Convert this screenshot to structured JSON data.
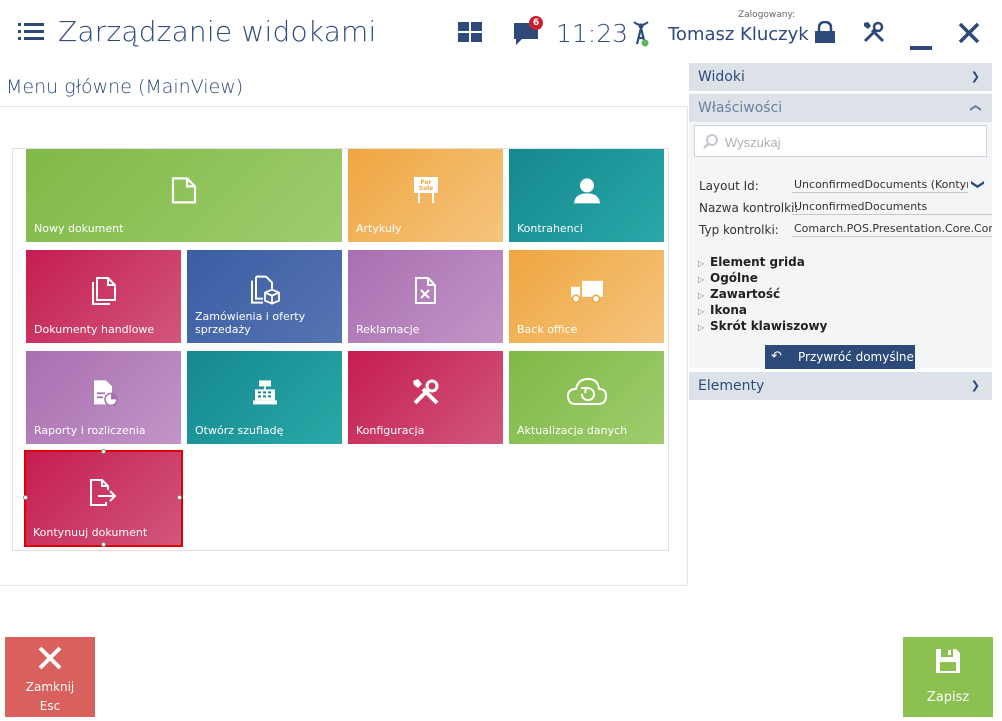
{
  "header": {
    "title": "Zarządzanie widokami",
    "time": "11:23",
    "notifications_count": "6",
    "logged_label": "Zalogowany:",
    "user_name": "Tomasz Kluczyk"
  },
  "view": {
    "title": "Menu główne (MainView)"
  },
  "tiles": [
    {
      "label": "Nowy dokument",
      "icon": "document-icon",
      "color": "#8cc152"
    },
    {
      "label": "Artykuły",
      "icon": "for-sale-sign-icon",
      "color": "#f0b05a"
    },
    {
      "label": "Kontrahenci",
      "icon": "person-icon",
      "color": "#1f9a9a"
    },
    {
      "label": "Dokumenty handlowe",
      "icon": "documents-icon",
      "color": "#c7305a"
    },
    {
      "label": "Zamówienia i oferty sprzedaży",
      "icon": "documents-box-icon",
      "color": "#3f62a5"
    },
    {
      "label": "Reklamacje",
      "icon": "document-cancel-icon",
      "color": "#b07ab6"
    },
    {
      "label": "Back office",
      "icon": "truck-icon",
      "color": "#f0b05a"
    },
    {
      "label": "Raporty i rozliczenia",
      "icon": "report-chart-icon",
      "color": "#b07ab6"
    },
    {
      "label": "Otwórz szufladę",
      "icon": "cash-register-icon",
      "color": "#1f9a9a"
    },
    {
      "label": "Konfiguracja",
      "icon": "tools-icon",
      "color": "#c7305a"
    },
    {
      "label": "Aktualizacja danych",
      "icon": "cloud-refresh-icon",
      "color": "#8cc152"
    },
    {
      "label": "Kontynuuj dokument",
      "icon": "document-arrow-icon",
      "color": "#c7305a"
    }
  ],
  "right_panel": {
    "widoki": "Widoki",
    "wlasciwosci": "Właściwości",
    "search_placeholder": "Wyszukaj",
    "props": [
      {
        "label": "Layout Id:",
        "value": "UnconfirmedDocuments (Kontynuuj"
      },
      {
        "label": "Nazwa kontrolki:",
        "value": "UnconfirmedDocuments"
      },
      {
        "label": "Typ kontrolki:",
        "value": "Comarch.POS.Presentation.Core.Contro"
      }
    ],
    "tree": [
      "Element grida",
      "Ogólne",
      "Zawartość",
      "Ikona",
      "Skrót klawiszowy"
    ],
    "restore_label": "Przywróć domyślne",
    "elementy": "Elementy"
  },
  "buttons": {
    "close_line1": "Zamknij",
    "close_line2": "Esc",
    "save": "Zapisz"
  }
}
